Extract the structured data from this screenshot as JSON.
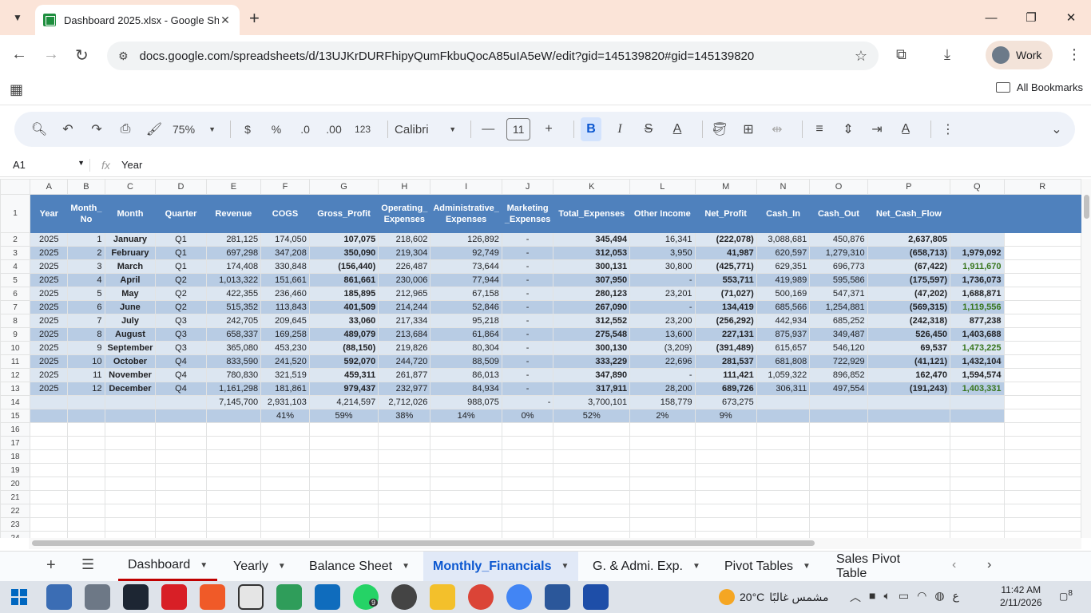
{
  "browser": {
    "tab_title": "Dashboard 2025.xlsx - Google She",
    "url": "docs.google.com/spreadsheets/d/13UJKrDURFhipyQumFkbuQocA85uIA5eW/edit?gid=145139820#gid=145139820",
    "profile_label": "Work",
    "bookmarks_label": "All Bookmarks"
  },
  "toolbar": {
    "zoom": "75%",
    "currency": "$",
    "percent": "%",
    "dec_decrease": ".0",
    "dec_increase": ".00",
    "number_format": "123",
    "font": "Calibri",
    "font_size": "11",
    "bold": "B",
    "italic": "I",
    "strike": "S",
    "text_color": "A"
  },
  "formula": {
    "cell_ref": "A1",
    "fx": "fx",
    "value": "Year"
  },
  "columns": [
    "A",
    "B",
    "C",
    "D",
    "E",
    "F",
    "G",
    "H",
    "I",
    "J",
    "K",
    "L",
    "M",
    "N",
    "O",
    "P",
    "Q",
    "R"
  ],
  "headers": [
    "Year",
    "Month_ No",
    "Month",
    "Quarter",
    "Revenue",
    "COGS",
    "Gross_Profit",
    "Operating_ Expenses",
    "Administrative_ Expenses",
    "Marketing _Expenses",
    "Total_Expenses",
    "Other Income",
    "Net_Profit",
    "Cash_In",
    "Cash_Out",
    "Net_Cash_Flow",
    "",
    ""
  ],
  "rows": [
    [
      "2025",
      "1",
      "January",
      "Q1",
      "281,125",
      "174,050",
      "107,075",
      "218,602",
      "126,892",
      "-",
      "345,494",
      "16,341",
      "(222,078)",
      "3,088,681",
      "450,876",
      "2,637,805",
      "",
      ""
    ],
    [
      "2025",
      "2",
      "February",
      "Q1",
      "697,298",
      "347,208",
      "350,090",
      "219,304",
      "92,749",
      "-",
      "312,053",
      "3,950",
      "41,987",
      "620,597",
      "1,279,310",
      "(658,713)",
      "1,979,092",
      ""
    ],
    [
      "2025",
      "3",
      "March",
      "Q1",
      "174,408",
      "330,848",
      "(156,440)",
      "226,487",
      "73,644",
      "-",
      "300,131",
      "30,800",
      "(425,771)",
      "629,351",
      "696,773",
      "(67,422)",
      "1,911,670",
      ""
    ],
    [
      "2025",
      "4",
      "April",
      "Q2",
      "1,013,322",
      "151,661",
      "861,661",
      "230,006",
      "77,944",
      "-",
      "307,950",
      "-",
      "553,711",
      "419,989",
      "595,586",
      "(175,597)",
      "1,736,073",
      ""
    ],
    [
      "2025",
      "5",
      "May",
      "Q2",
      "422,355",
      "236,460",
      "185,895",
      "212,965",
      "67,158",
      "-",
      "280,123",
      "23,201",
      "(71,027)",
      "500,169",
      "547,371",
      "(47,202)",
      "1,688,871",
      ""
    ],
    [
      "2025",
      "6",
      "June",
      "Q2",
      "515,352",
      "113,843",
      "401,509",
      "214,244",
      "52,846",
      "-",
      "267,090",
      "-",
      "134,419",
      "685,566",
      "1,254,881",
      "(569,315)",
      "1,119,556",
      ""
    ],
    [
      "2025",
      "7",
      "July",
      "Q3",
      "242,705",
      "209,645",
      "33,060",
      "217,334",
      "95,218",
      "-",
      "312,552",
      "23,200",
      "(256,292)",
      "442,934",
      "685,252",
      "(242,318)",
      "877,238",
      ""
    ],
    [
      "2025",
      "8",
      "August",
      "Q3",
      "658,337",
      "169,258",
      "489,079",
      "213,684",
      "61,864",
      "-",
      "275,548",
      "13,600",
      "227,131",
      "875,937",
      "349,487",
      "526,450",
      "1,403,688",
      ""
    ],
    [
      "2025",
      "9",
      "September",
      "Q3",
      "365,080",
      "453,230",
      "(88,150)",
      "219,826",
      "80,304",
      "-",
      "300,130",
      "(3,209)",
      "(391,489)",
      "615,657",
      "546,120",
      "69,537",
      "1,473,225",
      ""
    ],
    [
      "2025",
      "10",
      "October",
      "Q4",
      "833,590",
      "241,520",
      "592,070",
      "244,720",
      "88,509",
      "-",
      "333,229",
      "22,696",
      "281,537",
      "681,808",
      "722,929",
      "(41,121)",
      "1,432,104",
      ""
    ],
    [
      "2025",
      "11",
      "November",
      "Q4",
      "780,830",
      "321,519",
      "459,311",
      "261,877",
      "86,013",
      "-",
      "347,890",
      "-",
      "111,421",
      "1,059,322",
      "896,852",
      "162,470",
      "1,594,574",
      ""
    ],
    [
      "2025",
      "12",
      "December",
      "Q4",
      "1,161,298",
      "181,861",
      "979,437",
      "232,977",
      "84,934",
      "-",
      "317,911",
      "28,200",
      "689,726",
      "306,311",
      "497,554",
      "(191,243)",
      "1,403,331",
      ""
    ],
    [
      "",
      "",
      "",
      "",
      "7,145,700",
      "2,931,103",
      "4,214,597",
      "2,712,026",
      "988,075",
      "-",
      "3,700,101",
      "158,779",
      "673,275",
      "",
      "",
      "",
      "",
      ""
    ],
    [
      "",
      "",
      "",
      "",
      "",
      "41%",
      "59%",
      "38%",
      "14%",
      "0%",
      "52%",
      "2%",
      "9%",
      "",
      "",
      "",
      "",
      ""
    ]
  ],
  "sheet_tabs": [
    "Dashboard",
    "Yearly",
    "Balance Sheet",
    "Monthly_Financials",
    "G. & Admi. Exp.",
    "Pivot Tables",
    "Sales Pivot Table"
  ],
  "taskbar": {
    "weather_temp": "20°C",
    "weather_desc": "مشمس غالبًا",
    "time": "11:42 AM",
    "date": "2/11/2026",
    "lang": "ع",
    "notif_count": "8",
    "whatsapp_badge": "9"
  }
}
